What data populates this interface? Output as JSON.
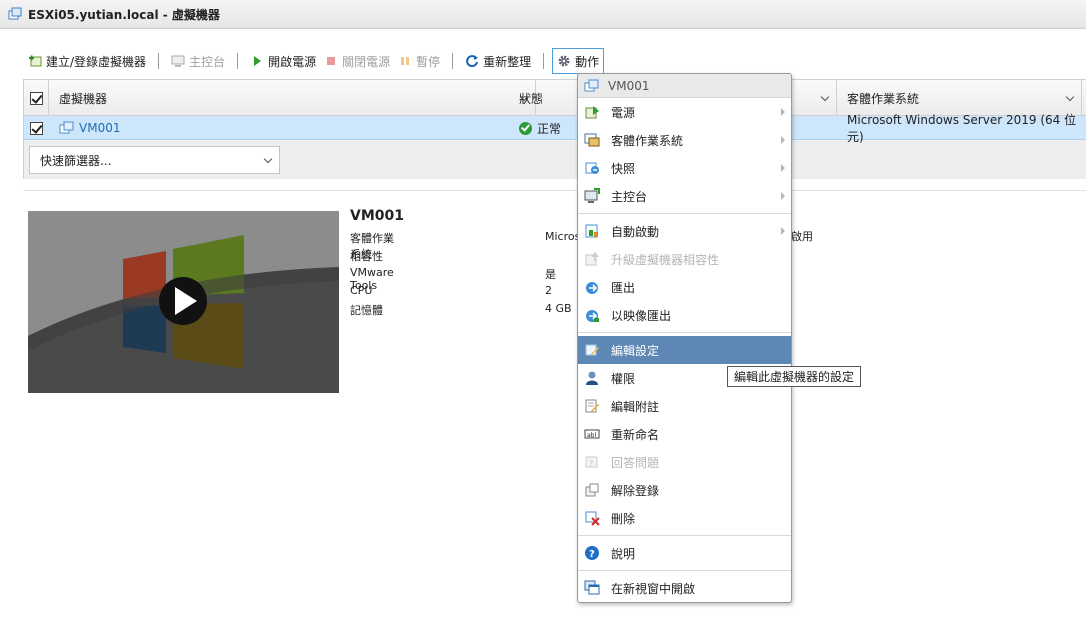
{
  "window": {
    "title": "ESXi05.yutian.local - 虛擬機器"
  },
  "toolbar": {
    "create_label": "建立/登錄虛擬機器",
    "console_label": "主控台",
    "power_on_label": "開啟電源",
    "power_off_label": "關閉電源",
    "suspend_label": "暫停",
    "refresh_label": "重新整理",
    "actions_label": "動作"
  },
  "grid": {
    "columns": {
      "name": "虛擬機器",
      "status": "狀態",
      "guest_os": "客體作業系統"
    },
    "rows": [
      {
        "name": "VM001",
        "status": "正常",
        "guest_os": "Microsoft Windows Server 2019 (64 位元)"
      }
    ],
    "filter": {
      "placeholder": "快速篩選器..."
    }
  },
  "details": {
    "name": "VM001",
    "rows": [
      {
        "key": "客體作業系統",
        "value": "Micros"
      },
      {
        "key": "相容性",
        "value": ""
      },
      {
        "key": "VMware Tools",
        "value": "是"
      },
      {
        "key": "CPU",
        "value": "2"
      },
      {
        "key": "記憶體",
        "value": "4 GB"
      }
    ],
    "partial_right": "啟用"
  },
  "menu": {
    "header": "VM001",
    "items": [
      {
        "label": "電源",
        "icon": "power-icon",
        "submenu": true
      },
      {
        "label": "客體作業系統",
        "icon": "guest-os-icon",
        "submenu": true
      },
      {
        "label": "快照",
        "icon": "snapshot-icon",
        "submenu": true
      },
      {
        "label": "主控台",
        "icon": "console-icon",
        "submenu": true
      },
      {
        "label": "自動啟動",
        "icon": "autostart-icon",
        "submenu": true
      },
      {
        "label": "升級虛擬機器相容性",
        "icon": "upgrade-icon",
        "disabled": true
      },
      {
        "label": "匯出",
        "icon": "export-icon"
      },
      {
        "label": "以映像匯出",
        "icon": "export-image-icon"
      },
      {
        "label": "編輯設定",
        "icon": "edit-settings-icon",
        "highlighted": true
      },
      {
        "label": "權限",
        "icon": "permissions-icon"
      },
      {
        "label": "編輯附註",
        "icon": "edit-notes-icon"
      },
      {
        "label": "重新命名",
        "icon": "rename-icon"
      },
      {
        "label": "回答問題",
        "icon": "answer-question-icon",
        "disabled": true
      },
      {
        "label": "解除登錄",
        "icon": "unregister-icon"
      },
      {
        "label": "刪除",
        "icon": "delete-icon"
      },
      {
        "label": "說明",
        "icon": "help-icon"
      },
      {
        "label": "在新視窗中開啟",
        "icon": "new-window-icon"
      }
    ]
  },
  "tooltip": {
    "text": "編輯此虛擬機器的設定"
  },
  "colors": {
    "accent": "#1a6fb7",
    "selected_row": "#cde6fb",
    "menu_highlight": "#5d87b4",
    "ok": "#2c9a3b"
  }
}
